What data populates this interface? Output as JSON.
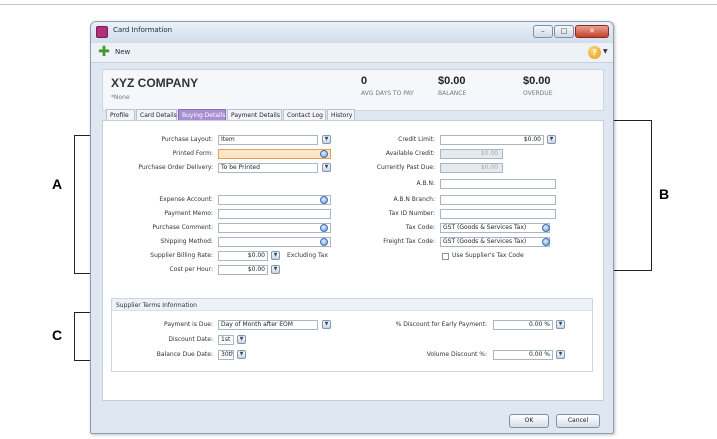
{
  "callouts": {
    "a": "A",
    "b": "B",
    "c": "C"
  },
  "window": {
    "title": "Card Information"
  },
  "toolbar": {
    "new_label": "New"
  },
  "header": {
    "company": "XYZ COMPANY",
    "subtitle": "*None",
    "stats": [
      {
        "value": "0",
        "label": "AVG DAYS TO PAY"
      },
      {
        "value": "$0.00",
        "label": "BALANCE"
      },
      {
        "value": "$0.00",
        "label": "OVERDUE"
      }
    ]
  },
  "tabs": [
    "Profile",
    "Card Details",
    "Buying Details",
    "Payment Details",
    "Contact Log",
    "History"
  ],
  "active_tab": "Buying Details",
  "left_form": {
    "purchase_layout": {
      "label": "Purchase Layout:",
      "value": "Item"
    },
    "printed_form": {
      "label": "Printed Form:",
      "value": ""
    },
    "po_delivery": {
      "label": "Purchase Order Delivery:",
      "value": "To be Printed"
    },
    "expense_account": {
      "label": "Expense Account:",
      "value": ""
    },
    "payment_memo": {
      "label": "Payment Memo:",
      "value": ""
    },
    "purchase_comment": {
      "label": "Purchase Comment:",
      "value": ""
    },
    "shipping_method": {
      "label": "Shipping Method:",
      "value": ""
    },
    "billing_rate": {
      "label": "Supplier Billing Rate:",
      "value": "$0.00",
      "suffix": "Excluding Tax"
    },
    "cost_per_hour": {
      "label": "Cost per Hour:",
      "value": "$0.00"
    }
  },
  "right_form": {
    "credit_limit": {
      "label": "Credit Limit:",
      "value": "$0.00"
    },
    "available_credit": {
      "label": "Available Credit:",
      "value": "$0.00"
    },
    "currently_past_due": {
      "label": "Currently Past Due:",
      "value": "$0.00"
    },
    "abn": {
      "label": "A.B.N:",
      "value": ""
    },
    "abn_branch": {
      "label": "A.B.N Branch:",
      "value": ""
    },
    "tax_id": {
      "label": "Tax ID Number:",
      "value": ""
    },
    "tax_code": {
      "label": "Tax Code:",
      "value": "GST (Goods & Services Tax)"
    },
    "freight_tax_code": {
      "label": "Freight Tax Code:",
      "value": "GST (Goods & Services Tax)"
    },
    "use_supplier_tax": {
      "label": "Use Supplier's Tax Code"
    }
  },
  "terms": {
    "title": "Supplier Terms Information",
    "payment_due": {
      "label": "Payment is Due:",
      "value": "Day of Month after EOM"
    },
    "discount_date": {
      "label": "Discount Date:",
      "value": "1st"
    },
    "balance_due_date": {
      "label": "Balance Due Date:",
      "value": "30th"
    },
    "early_payment": {
      "label": "% Discount for Early Payment:",
      "value": "0.00 %"
    },
    "volume_discount": {
      "label": "Volume Discount %:",
      "value": "0.00 %"
    }
  },
  "buttons": {
    "ok": "OK",
    "cancel": "Cancel"
  }
}
